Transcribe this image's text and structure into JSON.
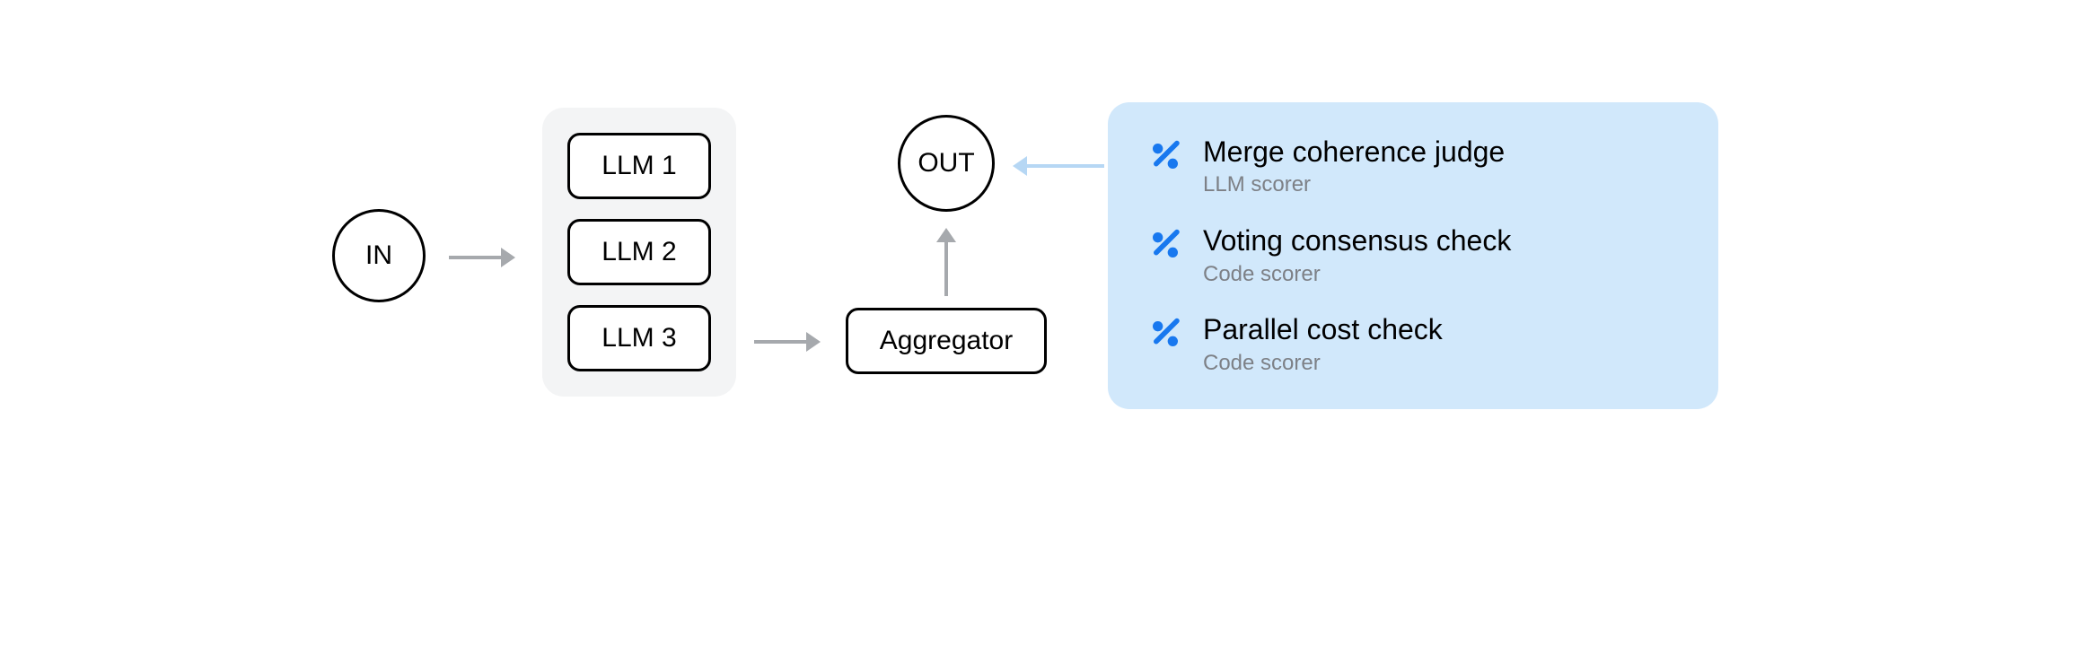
{
  "nodes": {
    "in_label": "IN",
    "out_label": "OUT",
    "aggregator_label": "Aggregator"
  },
  "llms": [
    {
      "label": "LLM 1"
    },
    {
      "label": "LLM 2"
    },
    {
      "label": "LLM 3"
    }
  ],
  "judges": [
    {
      "title": "Merge coherence judge",
      "subtitle": "LLM scorer"
    },
    {
      "title": "Voting consensus check",
      "subtitle": "Code scorer"
    },
    {
      "title": "Parallel cost check",
      "subtitle": "Code scorer"
    }
  ]
}
